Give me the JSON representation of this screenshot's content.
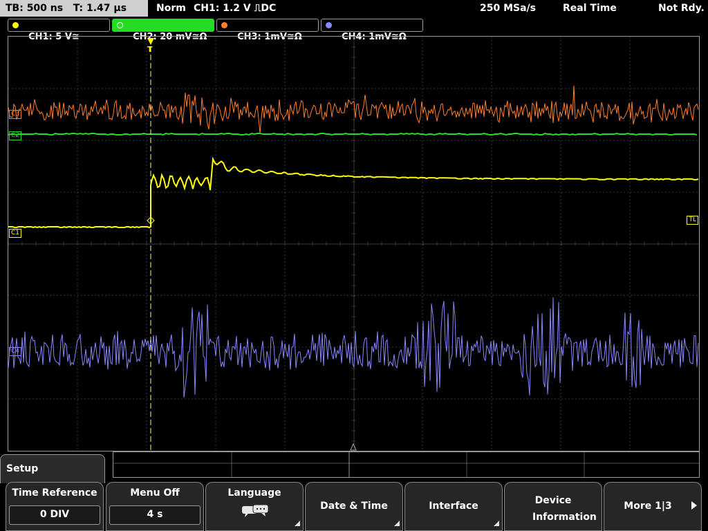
{
  "status": {
    "timebase": "TB: 500 ns",
    "trigger_time": "T: 1.47 µs",
    "mode": "Norm",
    "trigger_source": "CH1: 1.2 V ⎍DC",
    "sample_rate": "250 MSa/s",
    "acq_mode": "Real Time",
    "state": "Not Rdy."
  },
  "channels": [
    {
      "label": "CH1: 5 V≅",
      "color": "#ffff00"
    },
    {
      "label": "CH2: 20 mV≅Ω",
      "color": "#22dd22"
    },
    {
      "label": "CH3: 1mV≅Ω",
      "color": "#ff7f2a"
    },
    {
      "label": "CH4: 1mV≅Ω",
      "color": "#8888ff"
    }
  ],
  "markers": {
    "ch1": "C1",
    "ch2": "C2",
    "ch3": "C3",
    "ch4": "C4",
    "trigger_level": "TL",
    "trigger_position": "T"
  },
  "menu": {
    "title": "Setup",
    "softkeys": [
      {
        "label": "Time Reference",
        "value": "0 DIV"
      },
      {
        "label": "Menu Off",
        "value": "4 s"
      },
      {
        "label": "Language",
        "icon": "speech-bubbles-icon"
      },
      {
        "label": "Date & Time"
      },
      {
        "label": "Interface"
      },
      {
        "label": "Device Information"
      },
      {
        "label": "More 1|3",
        "icon": "next-arrow-icon"
      }
    ]
  }
}
